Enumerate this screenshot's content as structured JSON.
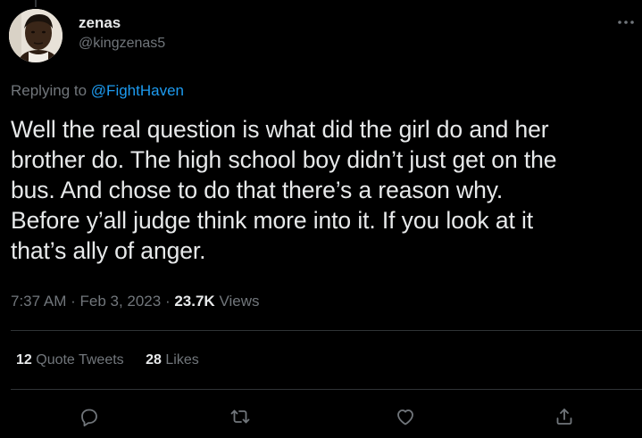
{
  "author": {
    "display_name": "zenas",
    "handle": "@kingzenas5"
  },
  "reply": {
    "prefix": "Replying to",
    "mention": "@FightHaven"
  },
  "tweet": {
    "line1": "Well the real question is what did the girl do and her",
    "line2": "brother do. The high school boy didn’t just get on the",
    "line3": "bus. And chose to do that there’s a reason why.",
    "line4": "Before y’all judge think more into it. If you look at it",
    "line5": "that’s ally of anger."
  },
  "meta": {
    "time": "7:37 AM",
    "sep1": " · ",
    "date": "Feb 3, 2023",
    "sep2": " · ",
    "views_count": "23.7K",
    "views_label": " Views"
  },
  "stats": {
    "quote_count": "12",
    "quote_label": " Quote Tweets",
    "likes_count": "28",
    "likes_label": " Likes"
  },
  "icons": {
    "more": "more-horizontal-icon",
    "reply": "reply-icon",
    "retweet": "retweet-icon",
    "like": "heart-icon",
    "share": "share-icon"
  },
  "colors": {
    "background": "#000000",
    "text": "#e7e9ea",
    "secondary": "#71767b",
    "accent": "#1d9bf0",
    "divider": "#2f3336"
  }
}
